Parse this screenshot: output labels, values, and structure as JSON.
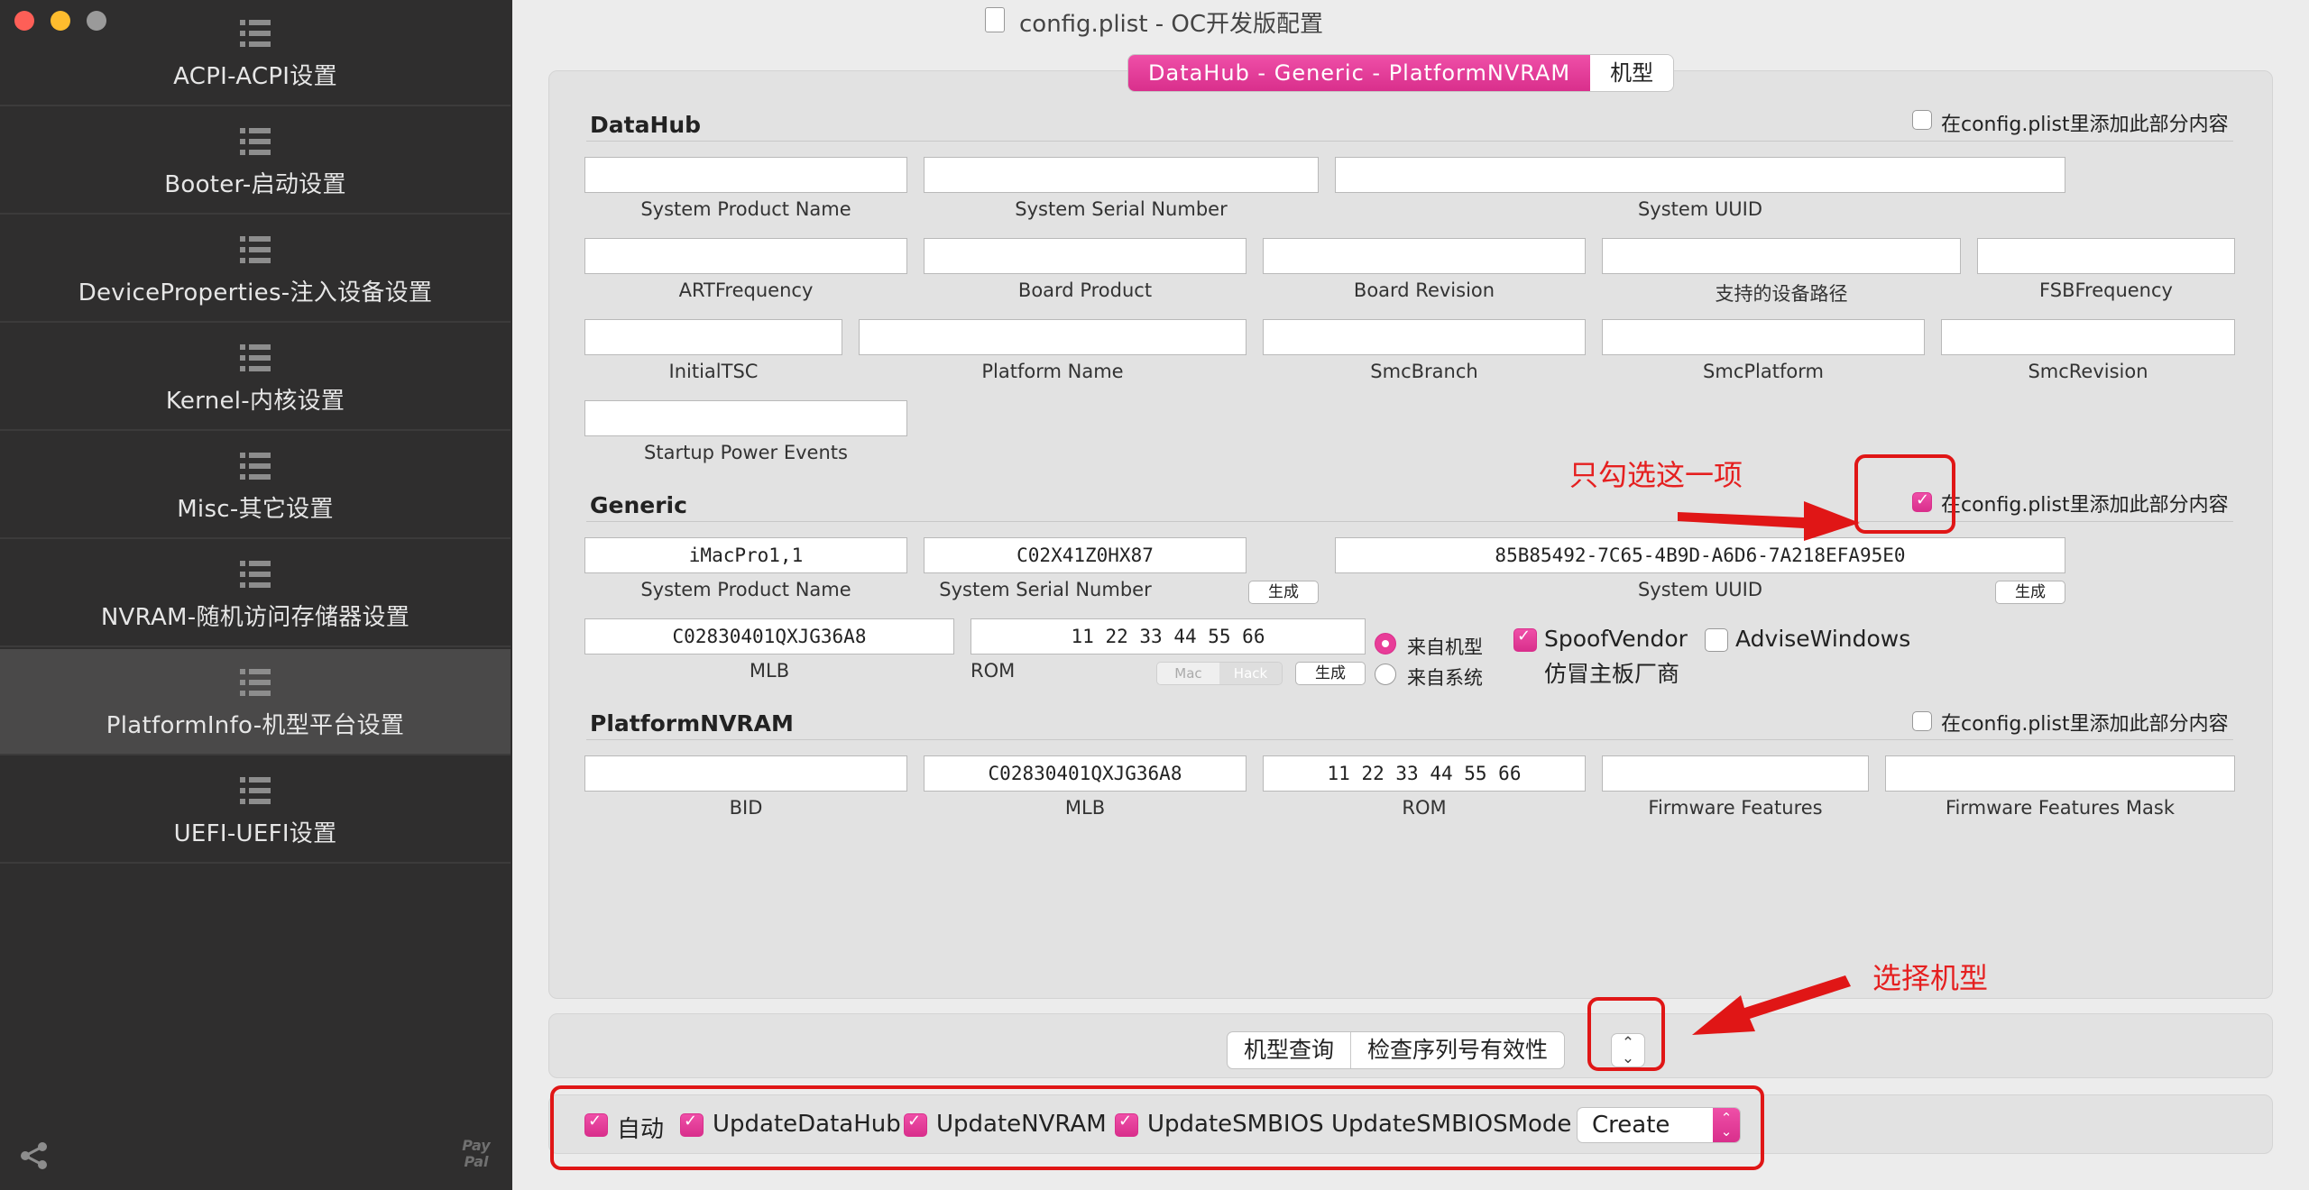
{
  "window": {
    "title": "config.plist - OC开发版配置"
  },
  "sidebar": {
    "items": [
      {
        "label": "ACPI-ACPI设置",
        "active": false
      },
      {
        "label": "Booter-启动设置",
        "active": false
      },
      {
        "label": "DeviceProperties-注入设备设置",
        "active": false
      },
      {
        "label": "Kernel-内核设置",
        "active": false
      },
      {
        "label": "Misc-其它设置",
        "active": false
      },
      {
        "label": "NVRAM-随机访问存储器设置",
        "active": false
      },
      {
        "label": "PlatformInfo-机型平台设置",
        "active": true
      },
      {
        "label": "UEFI-UEFI设置",
        "active": false
      }
    ],
    "footer_left_icon": "share-icon",
    "footer_right": "Pay Pal"
  },
  "tabs": {
    "active": "DataHub - Generic - PlatformNVRAM",
    "other": "机型"
  },
  "include_label": "在config.plist里添加此部分内容",
  "datahub": {
    "title": "DataHub",
    "include_checked": false,
    "fields": {
      "system_product_name": {
        "label": "System Product Name",
        "value": ""
      },
      "system_serial_number": {
        "label": "System Serial Number",
        "value": ""
      },
      "system_uuid": {
        "label": "System UUID",
        "value": ""
      },
      "art_frequency": {
        "label": "ARTFrequency",
        "value": ""
      },
      "board_product": {
        "label": "Board Product",
        "value": ""
      },
      "board_revision": {
        "label": "Board Revision",
        "value": ""
      },
      "device_path": {
        "label": "支持的设备路径",
        "value": ""
      },
      "fsb_frequency": {
        "label": "FSBFrequency",
        "value": ""
      },
      "initial_tsc": {
        "label": "InitialTSC",
        "value": ""
      },
      "platform_name": {
        "label": "Platform Name",
        "value": ""
      },
      "smc_branch": {
        "label": "SmcBranch",
        "value": ""
      },
      "smc_platform": {
        "label": "SmcPlatform",
        "value": ""
      },
      "smc_revision": {
        "label": "SmcRevision",
        "value": ""
      },
      "startup_power_events": {
        "label": "Startup Power Events",
        "value": ""
      }
    }
  },
  "generic": {
    "title": "Generic",
    "include_checked": true,
    "fields": {
      "system_product_name": {
        "label": "System Product Name",
        "value": "iMacPro1,1"
      },
      "system_serial_number": {
        "label": "System Serial Number",
        "value": "C02X41Z0HX87"
      },
      "system_uuid": {
        "label": "System UUID",
        "value": "85B85492-7C65-4B9D-A6D6-7A218EFA95E0"
      },
      "mlb": {
        "label": "MLB",
        "value": "C02830401QXJG36A8"
      },
      "rom": {
        "label": "ROM",
        "value": "11 22 33 44 55 66"
      }
    },
    "generate_label": "生成",
    "rom_mac": "Mac",
    "rom_hack": "Hack",
    "radio_from_model": "来自机型",
    "radio_from_system": "来自系统",
    "radio_selected": "来自机型",
    "spoof_vendor": {
      "label": "SpoofVendor",
      "checked": true,
      "sublabel": "仿冒主板厂商"
    },
    "advise_windows": {
      "label": "AdviseWindows",
      "checked": false
    }
  },
  "platform_nvram": {
    "title": "PlatformNVRAM",
    "include_checked": false,
    "fields": {
      "bid": {
        "label": "BID",
        "value": ""
      },
      "mlb": {
        "label": "MLB",
        "value": "C02830401QXJG36A8"
      },
      "rom": {
        "label": "ROM",
        "value": "11 22 33 44 55 66"
      },
      "firmware_features": {
        "label": "Firmware Features",
        "value": ""
      },
      "firmware_features_mask": {
        "label": "Firmware Features Mask",
        "value": ""
      }
    }
  },
  "lookup": {
    "model_query": "机型查询",
    "check_serial": "检查序列号有效性"
  },
  "bottom_bar": {
    "auto": {
      "label": "自动",
      "checked": true
    },
    "update_datahub": {
      "label": "UpdateDataHub",
      "checked": true
    },
    "update_nvram": {
      "label": "UpdateNVRAM",
      "checked": true
    },
    "update_smbios": {
      "label": "UpdateSMBIOS",
      "checked": true
    },
    "mode_label": "UpdateSMBIOSMode",
    "mode_value": "Create"
  },
  "annotations": {
    "only_check_this": "只勾选这一项",
    "select_model": "选择机型"
  },
  "colors": {
    "accent": "#e2378f",
    "annotation_red": "#e01616",
    "sidebar_bg": "#2f2e2e"
  }
}
